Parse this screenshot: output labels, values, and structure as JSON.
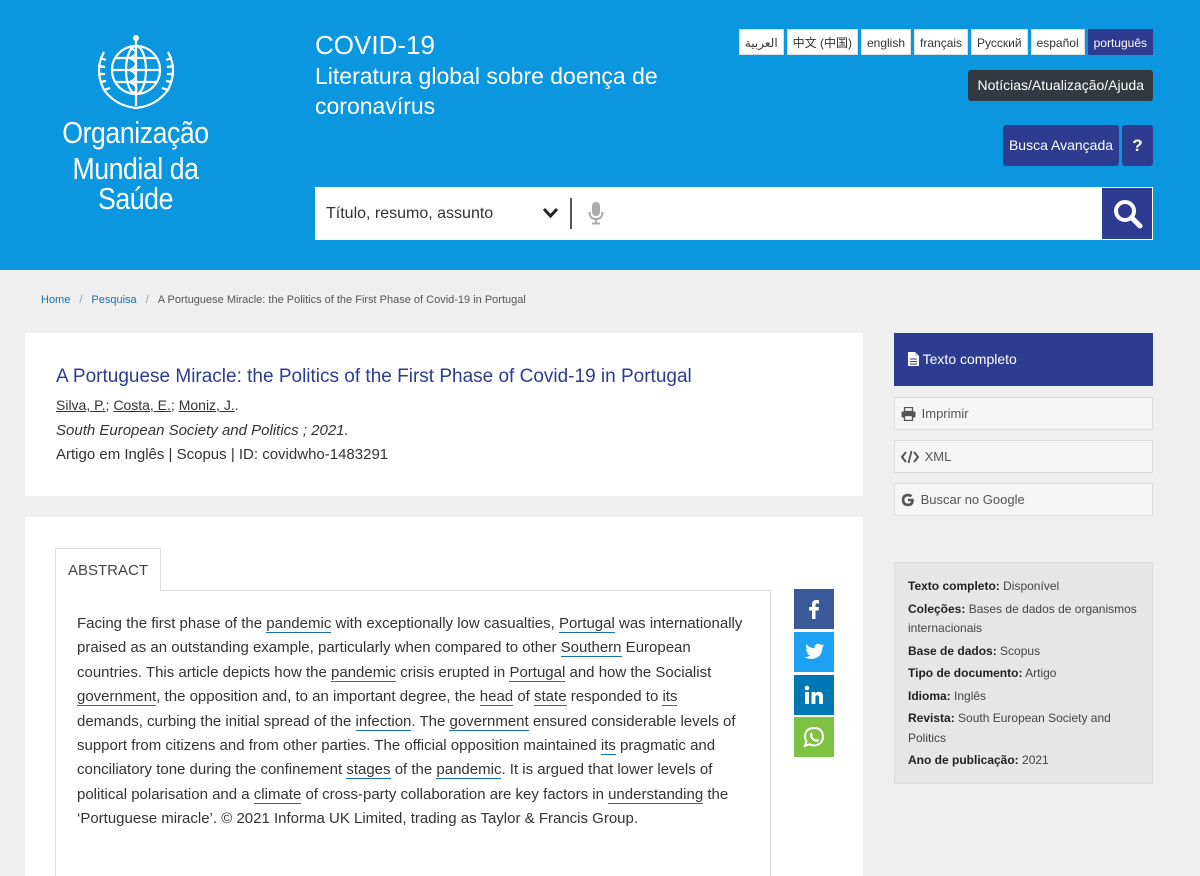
{
  "header": {
    "org_line1": "Organização",
    "org_line2": "Mundial da Saúde",
    "title": "COVID-19",
    "subtitle": "Literatura global sobre doença de coronavírus",
    "languages": [
      "العربية",
      "中文 (中国)",
      "english",
      "français",
      "Русский",
      "español",
      "português"
    ],
    "active_language": "português",
    "news_label": "Notícias/Atualização/Ajuda",
    "advanced_search_label": "Busca Avançada",
    "help_label": "?",
    "search": {
      "select_value": "Título, resumo, assunto",
      "placeholder": ""
    }
  },
  "breadcrumb": {
    "home": "Home",
    "search": "Pesquisa",
    "current": "A Portuguese Miracle: the Politics of the First Phase of Covid-19 in Portugal",
    "separator": "/"
  },
  "article": {
    "title": "A Portuguese Miracle: the Politics of the First Phase of Covid-19 in Portugal",
    "authors": [
      "Silva, P.",
      "Costa, E.",
      "Moniz, J."
    ],
    "author_sep": ";",
    "author_end": ".",
    "journal": "South European Society and Politics ; 2021.",
    "identifier": "Artigo em Inglês | Scopus | ID: covidwho-1483291"
  },
  "abstract": {
    "tab_label": "ABSTRACT",
    "segments": [
      {
        "t": "Facing the first phase of the "
      },
      {
        "t": "pandemic",
        "k": true
      },
      {
        "t": " with exceptionally low casualties, "
      },
      {
        "t": "Portugal",
        "k": true
      },
      {
        "t": " was internationally praised as an outstanding example, particularly when compared to other "
      },
      {
        "t": "Southern",
        "k": true
      },
      {
        "t": " European countries. This article depicts how the "
      },
      {
        "t": "pandemic",
        "k": true
      },
      {
        "t": " crisis erupted in "
      },
      {
        "t": "Portugal",
        "k": true
      },
      {
        "t": " and how the Socialist "
      },
      {
        "t": "government",
        "k": true
      },
      {
        "t": ", the opposition and, to an important degree, the "
      },
      {
        "t": "head",
        "k": true
      },
      {
        "t": " of "
      },
      {
        "t": "state",
        "k": true
      },
      {
        "t": " responded to "
      },
      {
        "t": "its",
        "k": true
      },
      {
        "t": " demands, curbing the initial spread of the "
      },
      {
        "t": "infection",
        "k": true
      },
      {
        "t": ". The "
      },
      {
        "t": "government",
        "k": true
      },
      {
        "t": " ensured considerable levels of support from citizens and from other parties. The official opposition maintained "
      },
      {
        "t": "its",
        "k": true
      },
      {
        "t": " pragmatic and conciliatory tone during the confinement "
      },
      {
        "t": "stages",
        "k": true
      },
      {
        "t": " of the "
      },
      {
        "t": "pandemic",
        "k": true
      },
      {
        "t": ". It is argued that lower levels of political polarisation and a "
      },
      {
        "t": "climate",
        "k": true
      },
      {
        "t": " of cross-party collaboration are key factors in "
      },
      {
        "t": "understanding",
        "k": true
      },
      {
        "t": " the ‘Portuguese miracle’. © 2021 Informa UK Limited, trading as Taylor & Francis Group."
      }
    ]
  },
  "share": [
    {
      "name": "facebook-icon",
      "color": "#3b5998"
    },
    {
      "name": "twitter-icon",
      "color": "#1da1f2"
    },
    {
      "name": "linkedin-icon",
      "color": "#0077b5"
    },
    {
      "name": "whatsapp-icon",
      "color": "#7dc242"
    }
  ],
  "sidebar": {
    "fulltext_label": "Texto completo",
    "print_label": "Imprimir",
    "xml_label": "XML",
    "google_label": "Buscar no Google",
    "info": [
      {
        "label": "Texto completo:",
        "value": "Disponível"
      },
      {
        "label": "Coleções:",
        "value": "Bases de dados de organismos internacionais"
      },
      {
        "label": "Base de dados:",
        "value": "Scopus"
      },
      {
        "label": "Tipo de documento:",
        "value": "Artigo"
      },
      {
        "label": "Idioma:",
        "value": "Inglês"
      },
      {
        "label": "Revista:",
        "value": "South European Society and Politics"
      },
      {
        "label": "Ano de publicação:",
        "value": "2021"
      }
    ]
  },
  "colors": {
    "header_blue": "#0b97e0",
    "primary_navy": "#2d3b91",
    "dark_button": "#333940",
    "link_blue": "#1a6fb3"
  }
}
